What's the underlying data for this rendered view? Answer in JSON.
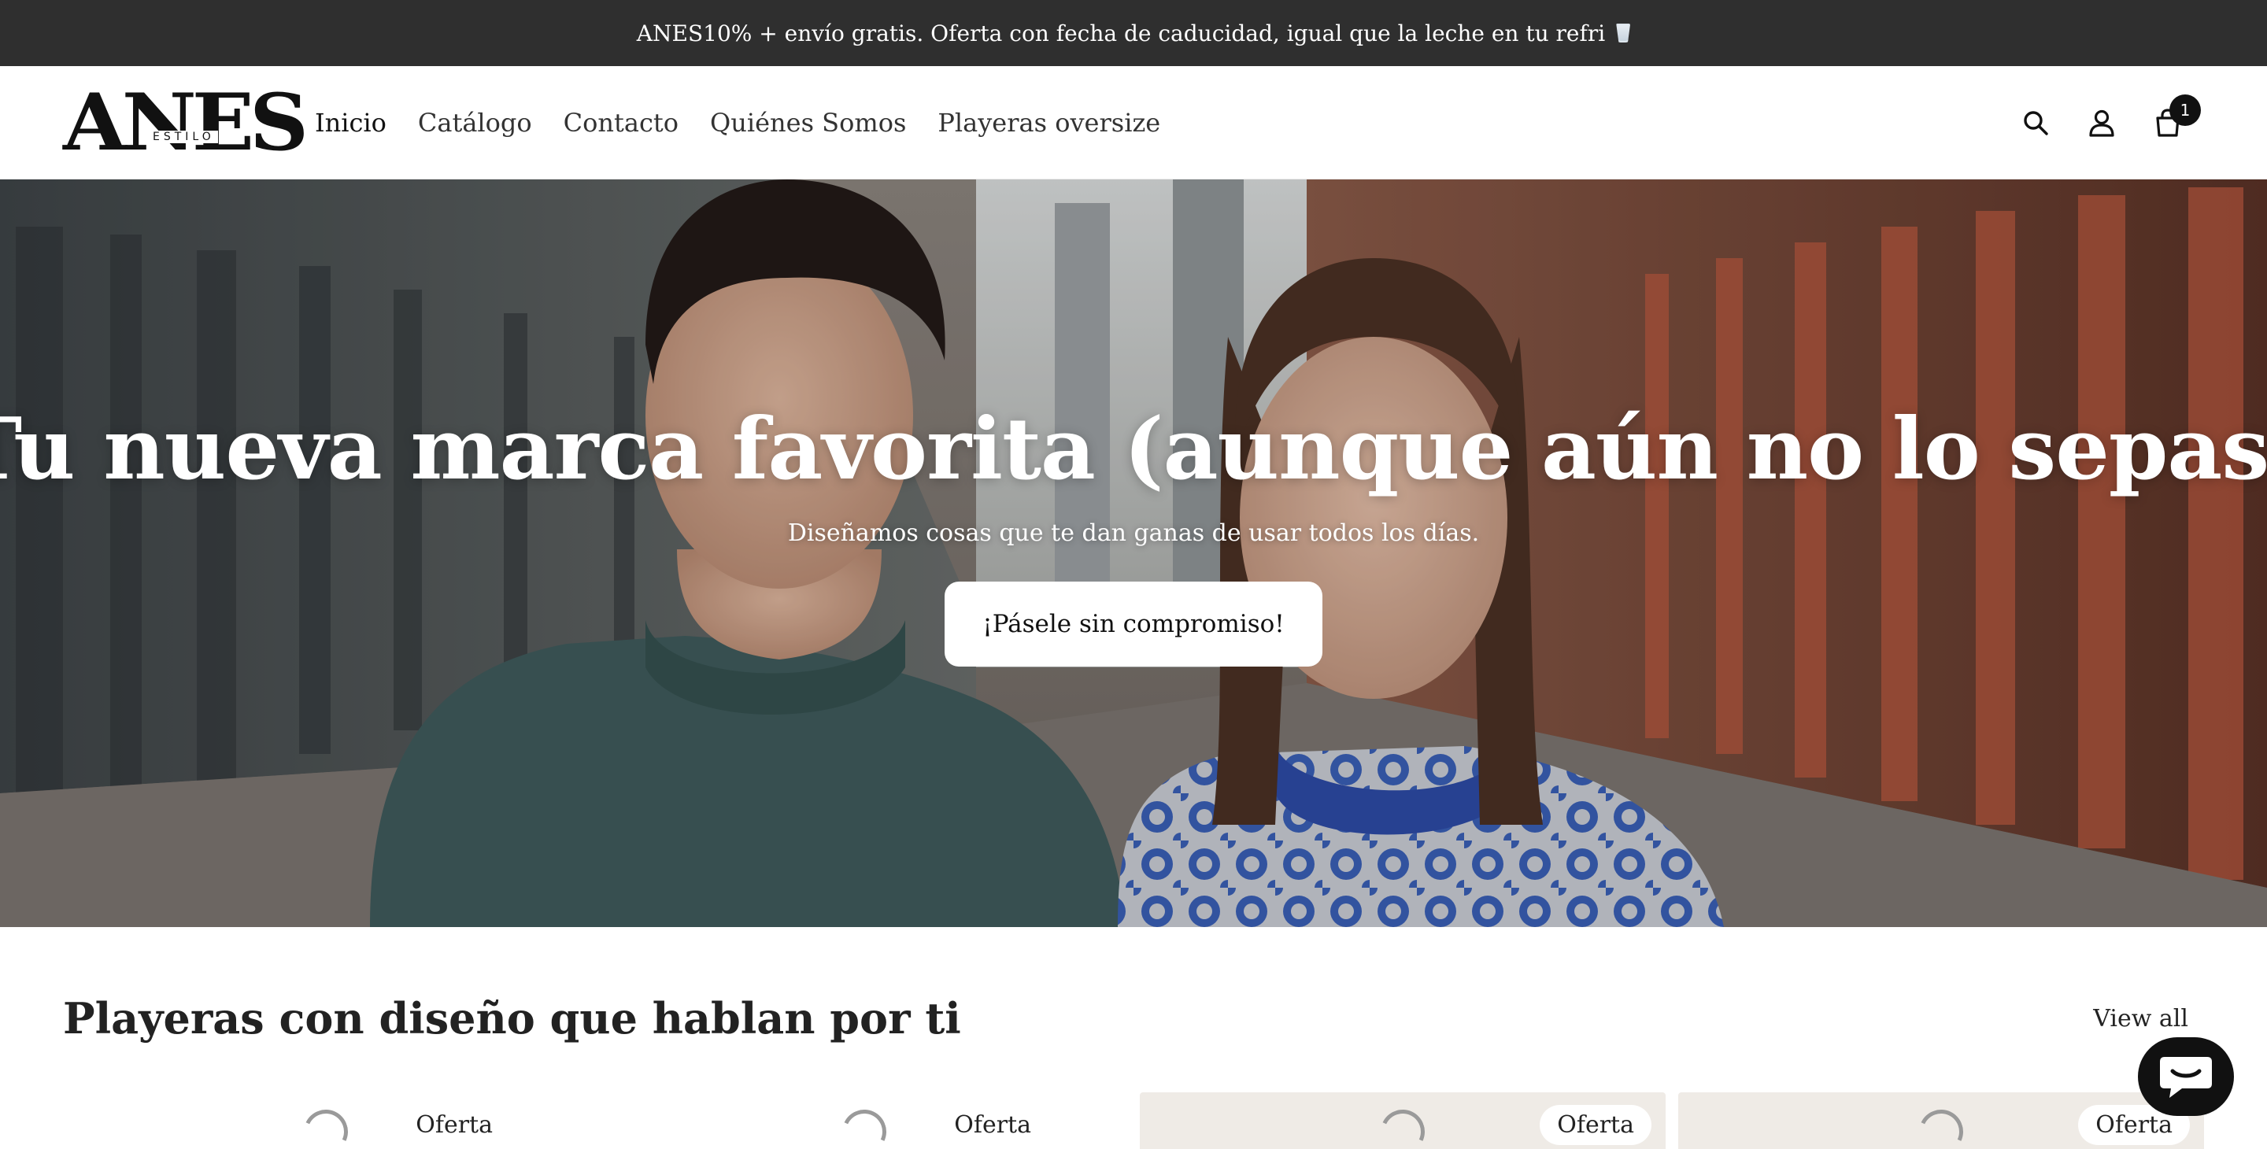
{
  "announcement": {
    "text": "ANES10% + envío gratis. Oferta con fecha de caducidad, igual que la leche en tu refri",
    "icon": "glass-icon"
  },
  "header": {
    "logo_text": "ANES",
    "logo_sub": "ESTILO",
    "nav": [
      {
        "label": "Inicio"
      },
      {
        "label": "Catálogo"
      },
      {
        "label": "Contacto"
      },
      {
        "label": "Quiénes Somos"
      },
      {
        "label": "Playeras oversize"
      }
    ],
    "icons": [
      "search-icon",
      "account-icon",
      "cart-icon"
    ],
    "cart_count": "1"
  },
  "hero": {
    "title": "Tu nueva marca favorita (aunque aún no lo sepas)",
    "subtitle": "Diseñamos cosas que te dan ganas de usar todos los días.",
    "button_label": "¡Pásele sin compromiso!"
  },
  "collection": {
    "title": "Playeras con diseño que hablan por ti",
    "view_all": "View all",
    "cards": [
      {
        "badge": "Oferta"
      },
      {
        "badge": "Oferta"
      },
      {
        "badge": "Oferta"
      },
      {
        "badge": "Oferta"
      }
    ]
  },
  "colors": {
    "announcement_bg": "#2f2f2f",
    "text": "#1e1e1e",
    "chat_bg": "#111111",
    "card_bg": "#efebe6"
  }
}
